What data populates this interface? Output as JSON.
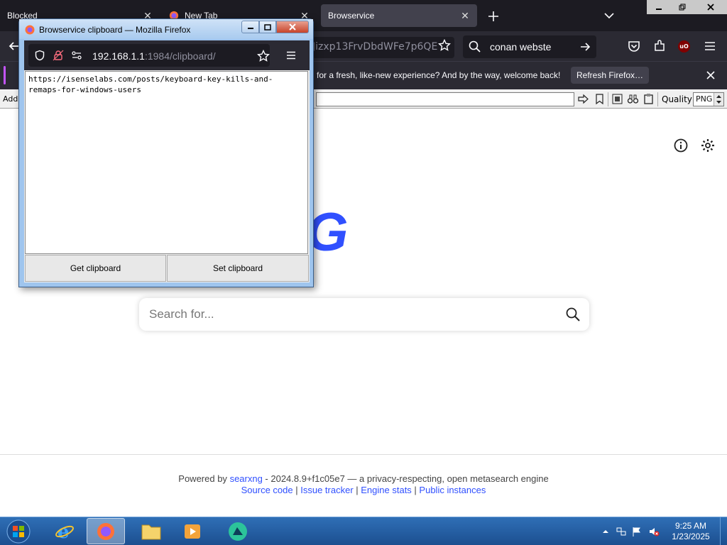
{
  "browser": {
    "tabs": [
      {
        "label": "Blocked",
        "active": false
      },
      {
        "label": "New Tab",
        "active": false
      },
      {
        "label": "Browservice",
        "active": true
      }
    ],
    "url_partial": "Jizxp13FrvDbdWFe7p6QE",
    "search_text": "conan webste"
  },
  "notification": {
    "text": "for a fresh, like-new experience? And by the way, welcome back!",
    "button": "Refresh Firefox…"
  },
  "addon_bar": {
    "label": "Add",
    "quality_label": "Quality",
    "quality_value": "PNG"
  },
  "page": {
    "logo": "arXNG",
    "search_placeholder": "Search for...",
    "footer": {
      "powered_by": "Powered by",
      "brand": "searxng",
      "version": " - 2024.8.9+f1c05e7 — a privacy-respecting, open metasearch engine",
      "links": [
        "Source code",
        "Issue tracker",
        "Engine stats",
        "Public instances"
      ],
      "sep": " | "
    }
  },
  "popup": {
    "title": "Browservice clipboard — Mozilla Firefox",
    "url_host": "192.168.1.1",
    "url_path": ":1984/clipboard/",
    "clipboard_text": "https://isenselabs.com/posts/keyboard-key-kills-and-remaps-for-windows-users",
    "get_button": "Get clipboard",
    "set_button": "Set clipboard"
  },
  "taskbar": {
    "time": "9:25 AM",
    "date": "1/23/2025"
  },
  "colors": {
    "logo": "#3050ff",
    "firefox_dark": "#1c1b22",
    "taskbar": "#1c4f90"
  }
}
